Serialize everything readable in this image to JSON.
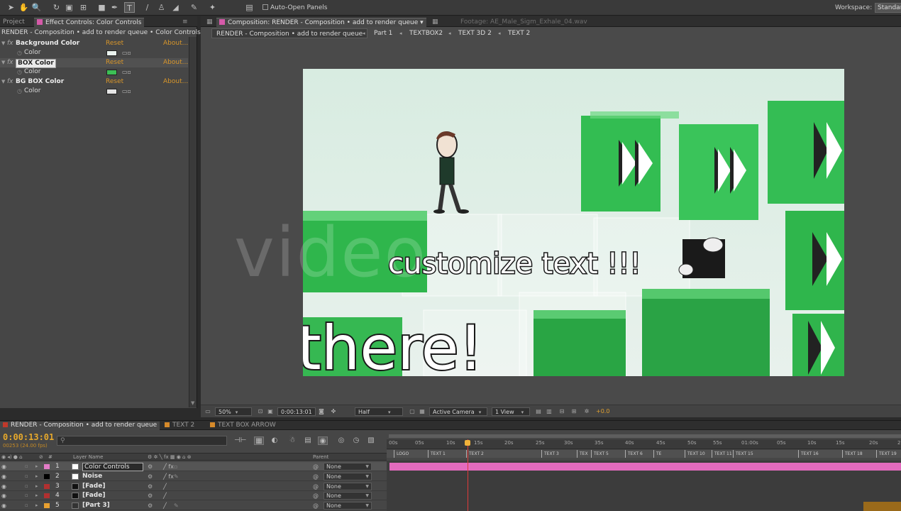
{
  "toolbar": {
    "auto_open": "Auto-Open Panels",
    "workspace_label": "Workspace:",
    "workspace_value": "Standard"
  },
  "left_panel": {
    "tab_project": "Project",
    "tab_effect": "Effect Controls: Color Controls",
    "path": "RENDER - Composition • add to render queue • Color Controls",
    "effects": [
      {
        "name": "Background Color",
        "reset": "Reset",
        "about": "About...",
        "prop": "Color",
        "color": "#e9f2ee"
      },
      {
        "name": "BOX Color",
        "reset": "Reset",
        "about": "About...",
        "prop": "Color",
        "color": "#3cbf55"
      },
      {
        "name": "BG BOX Color",
        "reset": "Reset",
        "about": "About...",
        "prop": "Color",
        "color": "#e5e5e5"
      }
    ]
  },
  "comp_panel": {
    "tab_comp": "Composition: RENDER - Composition • add to render queue",
    "tab_footage": "Footage: AE_Male_Sigm_Exhale_04.wav",
    "crumbs": [
      "RENDER - Composition • add to render queue",
      "Part 1",
      "TEXTBOX2",
      "TEXT 3D 2",
      "TEXT 2"
    ],
    "scene_text": "customize text !!!",
    "scene_text_2": "there!",
    "watermark": "video"
  },
  "viewer_controls": {
    "zoom": "50%",
    "timecode": "0:00:13:01",
    "resolution": "Half",
    "camera": "Active Camera",
    "view": "1 View",
    "exposure": "+0.0"
  },
  "timeline": {
    "tabs": [
      "RENDER - Composition • add to render queue",
      "TEXT 2",
      "TEXT BOX ARROW"
    ],
    "timecode": "0:00:13:01",
    "fps": "00253 (24.00 fps)",
    "col_layer_name": "Layer Name",
    "col_parent": "Parent",
    "ruler": [
      "00s",
      "05s",
      "10s",
      "15s",
      "20s",
      "25s",
      "30s",
      "35s",
      "40s",
      "45s",
      "50s",
      "55s",
      "01:00s",
      "05s",
      "10s",
      "15s",
      "20s",
      "25s"
    ],
    "markers": [
      "LOGO",
      "TEXT 1",
      "TEXT 2",
      "TEXT 3",
      "TEX",
      "TEXT 5",
      "TEXT 6",
      "TE",
      "TEXT 10",
      "TEXT 11",
      "TEXT 15",
      "TEXT 16",
      "TEXT 18",
      "TEXT 19"
    ],
    "layers": [
      {
        "num": "1",
        "name": "Color Controls",
        "parent": "None",
        "color": "#ffffff",
        "label": "#e37cc7"
      },
      {
        "num": "2",
        "name": "Noise",
        "parent": "None",
        "color": "#ffffff",
        "label": "#000000"
      },
      {
        "num": "3",
        "name": "[Fade]",
        "parent": "None",
        "color": "#111111",
        "label": "#b03030"
      },
      {
        "num": "4",
        "name": "[Fade]",
        "parent": "None",
        "color": "#111111",
        "label": "#b03030"
      },
      {
        "num": "5",
        "name": "[Part 3]",
        "parent": "None",
        "color": "#333333",
        "label": "#e8a030"
      }
    ]
  }
}
